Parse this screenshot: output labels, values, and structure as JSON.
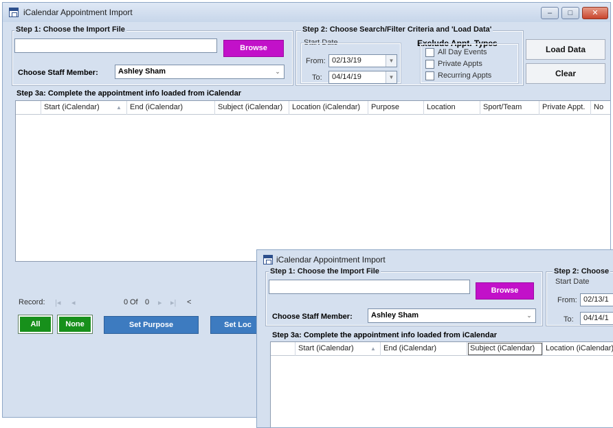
{
  "window": {
    "title": "iCalendar Appointment Import",
    "controls": {
      "minimize": "–",
      "maximize": "□",
      "close": "✕"
    }
  },
  "step1": {
    "title": "Step 1: Choose the Import File",
    "file_value": "",
    "browse_label": "Browse",
    "staff_label": "Choose Staff Member:",
    "staff_value": "Ashley Sham"
  },
  "step2": {
    "title": "Step 2: Choose Search/Filter Criteria and 'Load Data'",
    "title_cropped": "Step 2: Choose",
    "start_date_label": "Start Date",
    "from_label": "From:",
    "from_value": "02/13/19",
    "from_value_cropped": "02/13/1",
    "to_label": "To:",
    "to_value": "04/14/19",
    "to_value_cropped": "04/14/1",
    "exclude_title": "Exclude Appt. Types",
    "exclude_options": [
      "All Day Events",
      "Private Appts",
      "Recurring Appts"
    ],
    "load_label": "Load Data",
    "clear_label": "Clear"
  },
  "step3a": {
    "title": "Step 3a: Complete the appointment info loaded from iCalendar",
    "columns": [
      "Start (iCalendar)",
      "End (iCalendar)",
      "Subject (iCalendar)",
      "Location (iCalendar)",
      "Purpose",
      "Location",
      "Sport/Team",
      "Private Appt.",
      "No"
    ],
    "sort_indicator": "▲",
    "rows": []
  },
  "record_nav": {
    "label": "Record:",
    "first": "|◂",
    "prev": "◂",
    "current": "0",
    "of_label": "Of",
    "total": "0",
    "next": "▸",
    "last": "▸|",
    "scroll_left": "<"
  },
  "bottom_buttons": {
    "all": "All",
    "none": "None",
    "set_purpose": "Set Purpose",
    "set_location": "Set Loc"
  },
  "colors": {
    "window_bg": "#d5e0ef",
    "browse": "#c211c9",
    "green": "#17901b",
    "blue": "#3d7bc0"
  },
  "icons": [
    "app-calendar-icon",
    "dropdown-arrow-icon",
    "calendar-dropdown-icon"
  ]
}
